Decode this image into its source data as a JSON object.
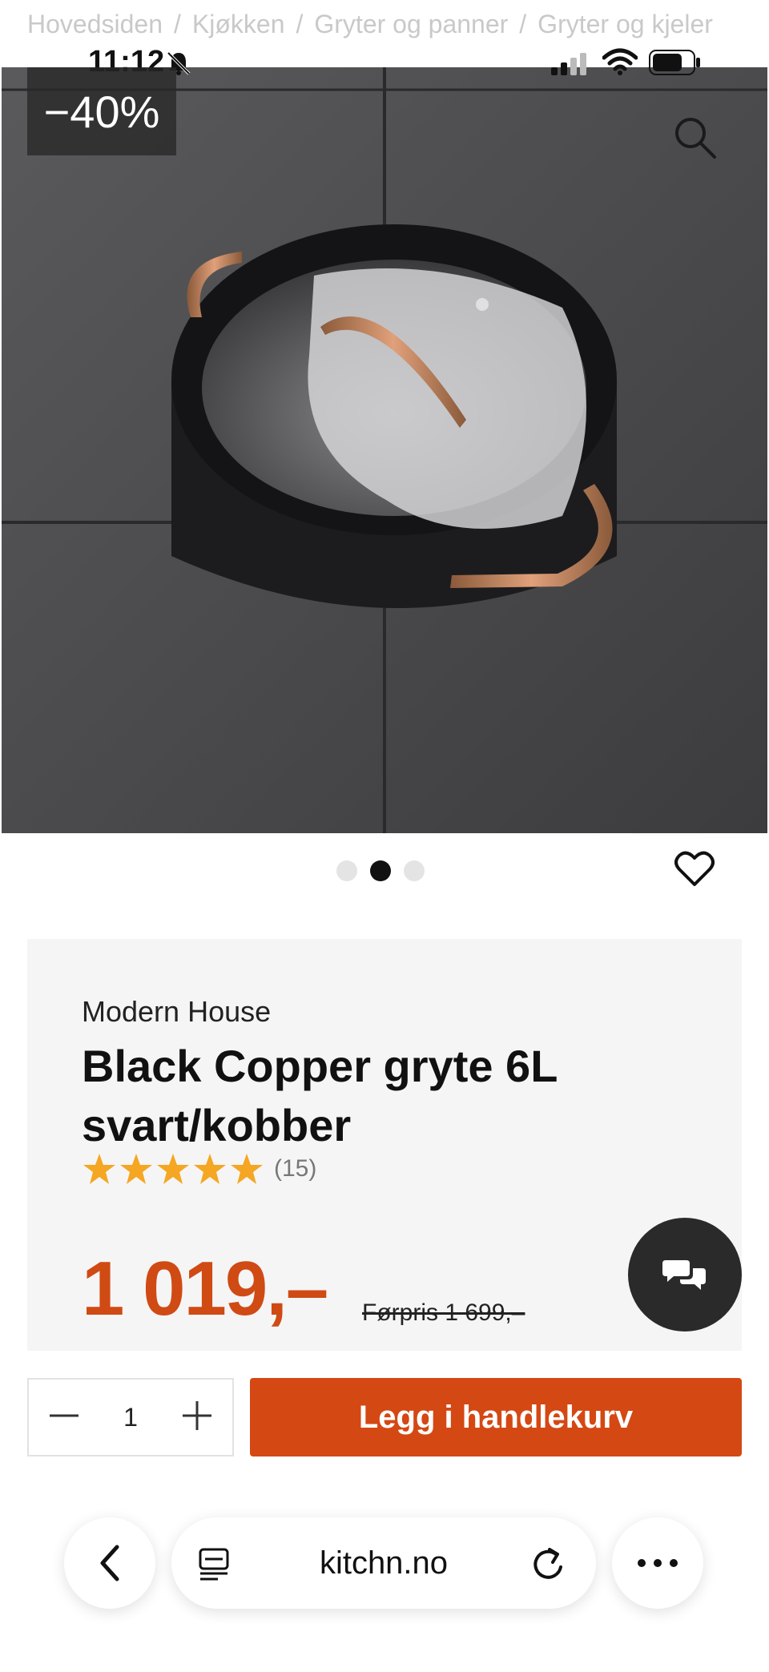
{
  "breadcrumb": {
    "items": [
      "Hovedsiden",
      "Kjøkken",
      "Gryter og panner",
      "Gryter og kjeler"
    ],
    "separator": "/"
  },
  "status_bar": {
    "time": "11:12"
  },
  "product_image": {
    "discount_badge": "−40%",
    "carousel": {
      "total": 3,
      "active_index": 1
    }
  },
  "product": {
    "brand": "Modern House",
    "title": "Black Copper gryte 6L svart/kobber",
    "rating_stars": 5,
    "review_count": "(15)",
    "price": "1 019,–",
    "previous_price": "Førpris 1 699,–"
  },
  "cart": {
    "quantity": "1",
    "add_label": "Legg i handlekurv"
  },
  "browser": {
    "url": "kitchn.no"
  },
  "colors": {
    "accent": "#d44813",
    "price": "#d04a14",
    "star": "#f5a623"
  }
}
